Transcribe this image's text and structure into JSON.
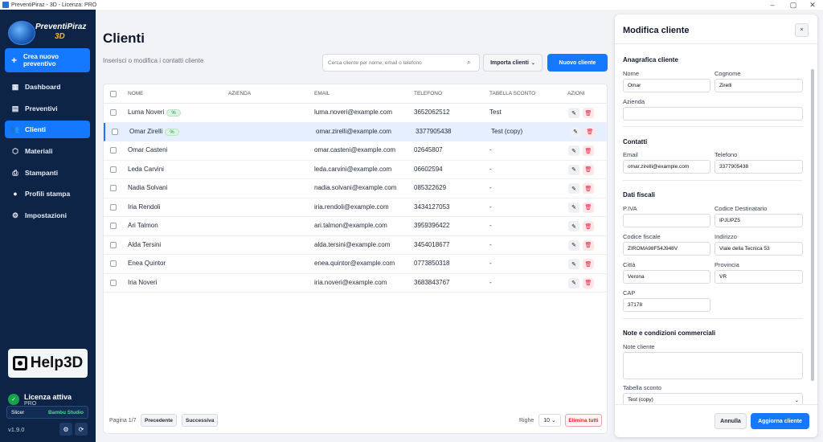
{
  "window": {
    "title": "PreventiPiraz - 3D - Licenza: PRO",
    "controls": {
      "minimize": "–",
      "maximize": "▢",
      "close": "✕"
    }
  },
  "sidebar": {
    "logo_line1": "PreventiPiraz",
    "logo_line2": "3D",
    "new_quote_line1": "Crea nuovo",
    "new_quote_line2": "preventivo",
    "items": [
      {
        "label": "Dashboard",
        "icon": "dashboard-icon",
        "glyph": "▦"
      },
      {
        "label": "Preventivi",
        "icon": "document-icon",
        "glyph": "▤"
      },
      {
        "label": "Clienti",
        "icon": "users-icon",
        "glyph": "👥"
      },
      {
        "label": "Materiali",
        "icon": "cube-icon",
        "glyph": "⬡"
      },
      {
        "label": "Stampanti",
        "icon": "printer-icon",
        "glyph": "⎙"
      },
      {
        "label": "Profili stampa",
        "icon": "user-icon",
        "glyph": "●"
      },
      {
        "label": "Impostazioni",
        "icon": "gear-icon",
        "glyph": "⚙"
      }
    ],
    "active_item": "Clienti",
    "help_logo": "Help3D",
    "license_title": "Licenza attiva",
    "license_tier": "PRO",
    "slicer_label": "Slicer",
    "slicer_value": "Bambu Studio",
    "version": "v1.9.0"
  },
  "main": {
    "title": "Clienti",
    "subtitle": "Inserisci o modifica i contatti cliente",
    "search_placeholder": "Cerca cliente per nome, email o telefono",
    "import_label": "Importa clienti",
    "new_client_label": "Nuovo cliente",
    "columns": [
      "NOME",
      "AZIENDA",
      "EMAIL",
      "TELEFONO",
      "TABELLA SCONTO",
      "AZIONI"
    ],
    "rows": [
      {
        "name": "Luma Noveri",
        "badge": "%",
        "company": "",
        "email": "luma.noveri@example.com",
        "phone": "3652062512",
        "discount": "Test"
      },
      {
        "name": "Omar Zirelli",
        "badge": "%",
        "company": "",
        "email": "omar.zirelli@example.com",
        "phone": "3377905438",
        "discount": "Test (copy)"
      },
      {
        "name": "Omar Casteni",
        "badge": "",
        "company": "",
        "email": "omar.casteni@example.com",
        "phone": "02645807",
        "discount": "-"
      },
      {
        "name": "Leda Carvini",
        "badge": "",
        "company": "",
        "email": "leda.carvini@example.com",
        "phone": "06602594",
        "discount": "-"
      },
      {
        "name": "Nadia Solvani",
        "badge": "",
        "company": "",
        "email": "nadia.solvani@example.com",
        "phone": "085322629",
        "discount": "-"
      },
      {
        "name": "Iria Rendoli",
        "badge": "",
        "company": "",
        "email": "iria.rendoli@example.com",
        "phone": "3434127053",
        "discount": "-"
      },
      {
        "name": "Ari Talmon",
        "badge": "",
        "company": "",
        "email": "ari.talmon@example.com",
        "phone": "3959396422",
        "discount": "-"
      },
      {
        "name": "Alda Tersini",
        "badge": "",
        "company": "",
        "email": "alda.tersini@example.com",
        "phone": "3454018677",
        "discount": "-"
      },
      {
        "name": "Enea Quintor",
        "badge": "",
        "company": "",
        "email": "enea.quintor@example.com",
        "phone": "0773850318",
        "discount": "-"
      },
      {
        "name": "Iria Noveri",
        "badge": "",
        "company": "",
        "email": "iria.noveri@example.com",
        "phone": "3683843767",
        "discount": "-"
      }
    ],
    "selected_row": 1,
    "pagination": {
      "page_text": "Pagina 1/7",
      "prev_label": "Precedente",
      "next_label": "Successiva",
      "rows_label": "Righe",
      "rows_value": "10 ⌄",
      "delete_all_label": "Elimina tutti"
    }
  },
  "panel": {
    "title": "Modifica cliente",
    "close_glyph": "×",
    "sections": {
      "anagrafica": "Anagrafica cliente",
      "contatti": "Contatti",
      "fiscali": "Dati fiscali",
      "note": "Note e condizioni commerciali"
    },
    "fields": {
      "nome": {
        "label": "Nome",
        "value": "Omar"
      },
      "cognome": {
        "label": "Cognome",
        "value": "Zirelli"
      },
      "azienda": {
        "label": "Azienda",
        "value": ""
      },
      "email": {
        "label": "Email",
        "value": "omar.zirelli@example.com"
      },
      "telefono": {
        "label": "Telefono",
        "value": "3377905438"
      },
      "piva": {
        "label": "P.IVA",
        "value": ""
      },
      "codice_destinatario": {
        "label": "Codice Destinatario",
        "value": "IPJUPZ5"
      },
      "codice_fiscale": {
        "label": "Codice fiscale",
        "value": "ZIROMA98F54J948V"
      },
      "indirizzo": {
        "label": "Indirizzo",
        "value": "Viale della Tecnica 53"
      },
      "citta": {
        "label": "Città",
        "value": "Verona"
      },
      "provincia": {
        "label": "Provincia",
        "value": "VR"
      },
      "cap": {
        "label": "CAP",
        "value": "37178"
      },
      "note_cliente": {
        "label": "Note cliente",
        "value": ""
      },
      "tabella_sconto": {
        "label": "Tabella sconto",
        "value": "Test (copy)"
      }
    },
    "cancel_label": "Annulla",
    "save_label": "Aggiorna cliente"
  },
  "colors": {
    "sidebar_bg": "#0e2447",
    "accent": "#1479ff",
    "danger": "#dc2626",
    "badge_green": "#1f8a43"
  }
}
